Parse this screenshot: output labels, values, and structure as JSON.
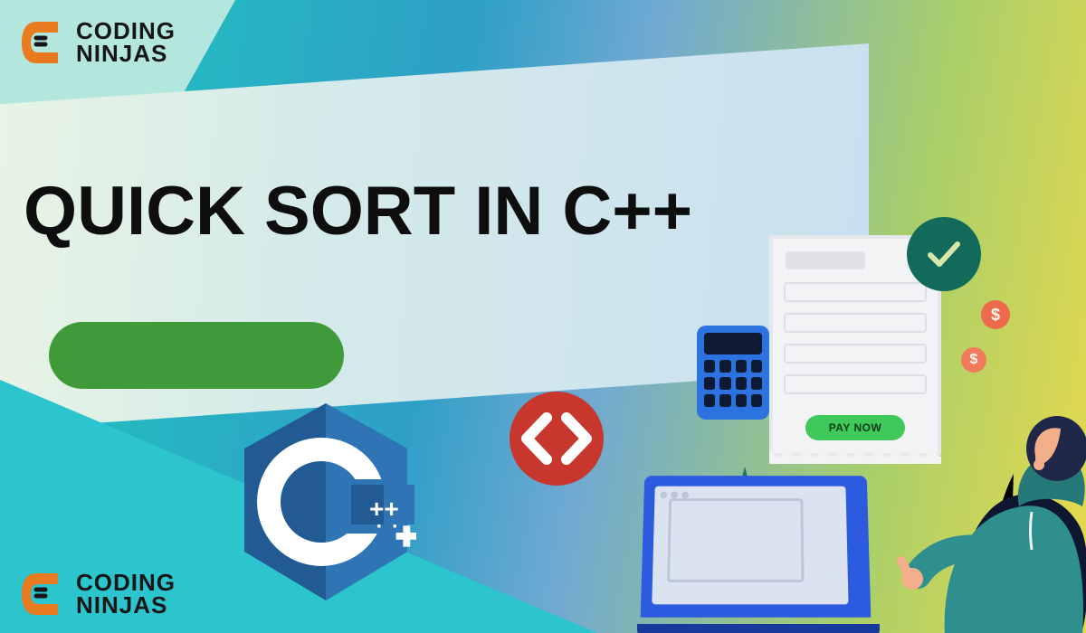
{
  "brand": {
    "line1": "CODING",
    "line2": "NINJAS",
    "accent": "#e87b1f",
    "dark": "#161616"
  },
  "headline": "QUICK SORT IN C++",
  "paper": {
    "cta": "PAY NOW"
  },
  "coins": {
    "symbol": "$"
  },
  "codeBadge": {
    "glyph": "code-icon"
  },
  "cpp": {
    "label": "++"
  },
  "colors": {
    "pill": "#3f9a3a",
    "checkBadge": "#126b5a",
    "codeBadge": "#c8372e",
    "calculator": "#2c73e0",
    "coin": "#ed6a4c",
    "laptop": "#2d5be0",
    "hoodie": "#2e8f8e",
    "hair": "#20284a",
    "skin": "#f3af8a"
  }
}
